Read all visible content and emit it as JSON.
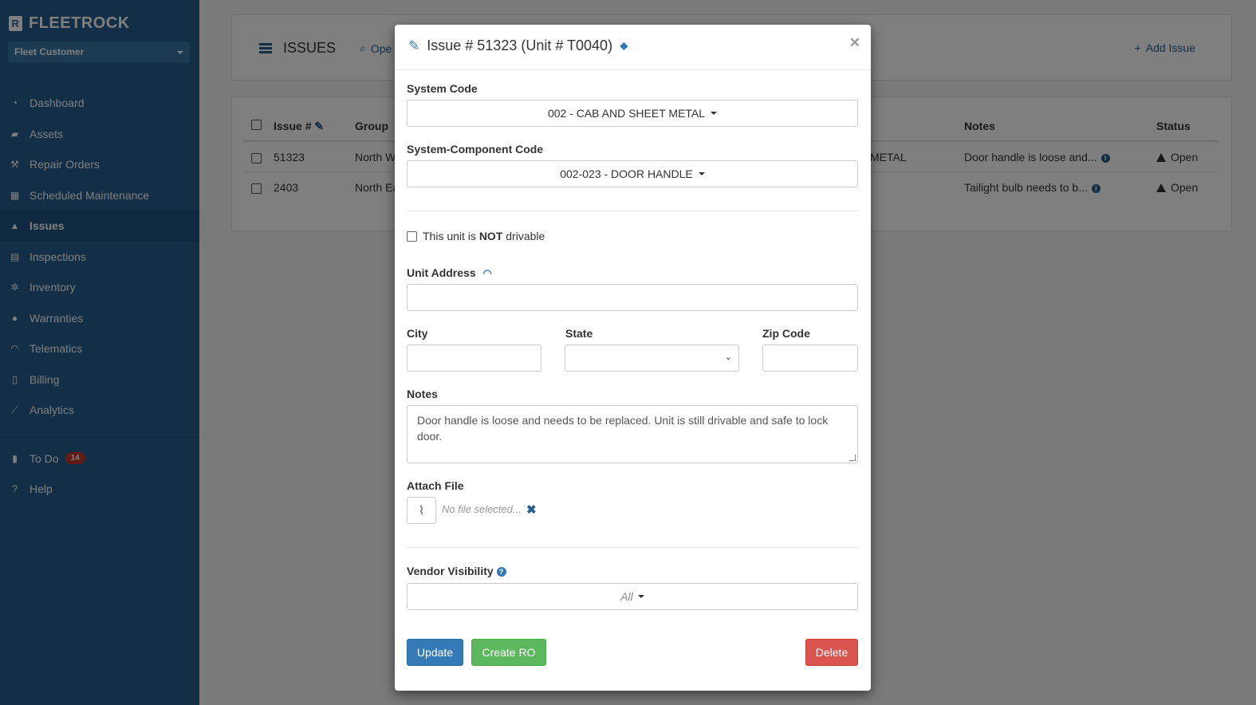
{
  "app": {
    "brand": "FLEETROCK",
    "brand_letter": "R",
    "account": "Fleet Customer"
  },
  "sidebar": {
    "items": [
      {
        "label": "Dashboard",
        "icon": "dashboard-icon"
      },
      {
        "label": "Assets",
        "icon": "truck-icon"
      },
      {
        "label": "Repair Orders",
        "icon": "wrench-icon"
      },
      {
        "label": "Scheduled Maintenance",
        "icon": "calendar-icon"
      },
      {
        "label": "Issues",
        "icon": "warning-icon",
        "active": true
      },
      {
        "label": "Inspections",
        "icon": "clipboard-icon"
      },
      {
        "label": "Inventory",
        "icon": "cogs-icon"
      },
      {
        "label": "Warranties",
        "icon": "circle-icon"
      },
      {
        "label": "Telematics",
        "icon": "wifi-icon"
      },
      {
        "label": "Billing",
        "icon": "file-icon"
      },
      {
        "label": "Analytics",
        "icon": "chart-icon"
      }
    ],
    "secondary": [
      {
        "label": "To Do",
        "icon": "book-icon",
        "badge": "14"
      },
      {
        "label": "Help",
        "icon": "question-icon"
      }
    ]
  },
  "header": {
    "title": "ISSUES",
    "search_hint": "Ope",
    "add_issue": "Add Issue"
  },
  "table": {
    "columns": {
      "issue": "Issue #",
      "group": "Group",
      "notes": "Notes",
      "status": "Status"
    },
    "rows": [
      {
        "issue": "51323",
        "group": "North We",
        "component": "METAL",
        "notes": "Door handle is loose and...",
        "status": "Open"
      },
      {
        "issue": "2403",
        "group": "North Ea",
        "component": "",
        "notes": "Tailight bulb needs to b...",
        "status": "Open"
      }
    ]
  },
  "modal": {
    "title": "Issue # 51323 (Unit # T0040)",
    "system_code_label": "System Code",
    "system_code_value": "002 - CAB AND SHEET METAL",
    "component_label": "System-Component Code",
    "component_value": "002-023 - DOOR HANDLE",
    "not_drivable_prefix": "This unit is ",
    "not_drivable_bold": "NOT",
    "not_drivable_suffix": " drivable",
    "address_label": "Unit Address",
    "city_label": "City",
    "state_label": "State",
    "zip_label": "Zip Code",
    "notes_label": "Notes",
    "notes_value": "Door handle is loose and needs to be replaced. Unit is still drivable and safe to lock door.",
    "attach_label": "Attach File",
    "no_file": "No file selected...",
    "vendor_visibility_label": "Vendor Visibility",
    "vendor_visibility_value": "All",
    "update": "Update",
    "create_ro": "Create RO",
    "delete": "Delete",
    "close": "×"
  },
  "colors": {
    "sidebar": "#255e8e",
    "primary": "#337ab7",
    "success": "#5cb85c",
    "danger": "#d9534f",
    "badge": "#c0392b"
  }
}
